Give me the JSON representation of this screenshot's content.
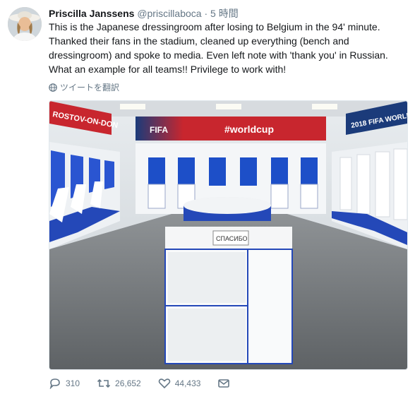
{
  "tweet": {
    "author_name": "Priscilla Janssens",
    "handle": "@priscillaboca",
    "separator": "·",
    "time": "5 時間",
    "text": "This is the Japanese dressingroom after losing to Belgium in the 94' minute. Thanked their fans in the stadium, cleaned up everything (bench and dressingroom) and spoke to media. Even left note with 'thank you' in Russian. What an example for all teams!! Privilege to work with!",
    "translate_label": "ツイートを翻訳"
  },
  "photo": {
    "banner_left": "ROSTOV-ON-DON",
    "banner_fifa": "FIFA",
    "banner_hashtag": "#worldcup",
    "banner_right": "2018 FIFA WORLD",
    "note_text": "СПАСИБО"
  },
  "actions": {
    "replies": "310",
    "retweets": "26,652",
    "likes": "44,433"
  },
  "colors": {
    "text_primary": "#14171a",
    "text_secondary": "#657786",
    "banner_red": "#c8262e",
    "banner_navy": "#1b3b7a",
    "locker_blue": "#1d4fc8"
  },
  "icons": [
    "globe-icon",
    "reply-icon",
    "retweet-icon",
    "like-icon",
    "dm-icon"
  ]
}
